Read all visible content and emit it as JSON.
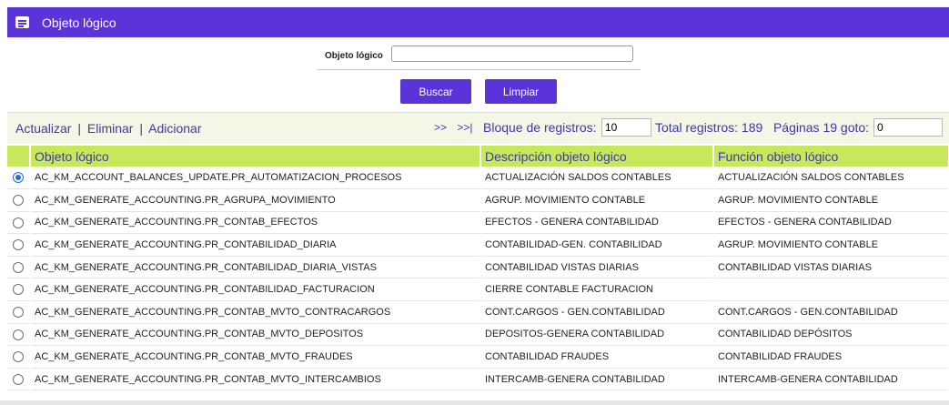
{
  "window": {
    "title": "Objeto lógico",
    "icon": "window-icon"
  },
  "search": {
    "label": "Objeto lógico",
    "value": ""
  },
  "buttons": {
    "buscar": "Buscar",
    "limpiar": "Limpiar"
  },
  "toolbar": {
    "actualizar": "Actualizar",
    "eliminar": "Eliminar",
    "adicionar": "Adicionar",
    "separator": "|",
    "next": ">>",
    "last": ">>|",
    "bloque_label": "Bloque de registros:",
    "bloque_value": "10",
    "total_label": "Total registros: 189",
    "paginas_label": "Páginas 19 goto:",
    "goto_value": "0"
  },
  "table": {
    "headers": [
      "Objeto lógico",
      "Descripción objeto lógico",
      "Función objeto lógico"
    ],
    "rows": [
      {
        "selected": true,
        "objeto": "AC_KM_ACCOUNT_BALANCES_UPDATE.PR_AUTOMATIZACION_PROCESOS",
        "descripcion": "ACTUALIZACIÓN SALDOS CONTABLES",
        "funcion": "ACTUALIZACIÓN SALDOS CONTABLES"
      },
      {
        "selected": false,
        "objeto": "AC_KM_GENERATE_ACCOUNTING.PR_AGRUPA_MOVIMIENTO",
        "descripcion": "AGRUP. MOVIMIENTO CONTABLE",
        "funcion": "AGRUP. MOVIMIENTO CONTABLE"
      },
      {
        "selected": false,
        "objeto": "AC_KM_GENERATE_ACCOUNTING.PR_CONTAB_EFECTOS",
        "descripcion": "EFECTOS - GENERA CONTABILIDAD",
        "funcion": "EFECTOS - GENERA CONTABILIDAD"
      },
      {
        "selected": false,
        "objeto": "AC_KM_GENERATE_ACCOUNTING.PR_CONTABILIDAD_DIARIA",
        "descripcion": "CONTABILIDAD-GEN. CONTABILIDAD",
        "funcion": "AGRUP. MOVIMIENTO CONTABLE"
      },
      {
        "selected": false,
        "objeto": "AC_KM_GENERATE_ACCOUNTING.PR_CONTABILIDAD_DIARIA_VISTAS",
        "descripcion": "CONTABILIDAD VISTAS DIARIAS",
        "funcion": "CONTABILIDAD VISTAS DIARIAS"
      },
      {
        "selected": false,
        "objeto": "AC_KM_GENERATE_ACCOUNTING.PR_CONTABILIDAD_FACTURACION",
        "descripcion": "CIERRE CONTABLE FACTURACION",
        "funcion": ""
      },
      {
        "selected": false,
        "objeto": "AC_KM_GENERATE_ACCOUNTING.PR_CONTAB_MVTO_CONTRACARGOS",
        "descripcion": "CONT.CARGOS - GEN.CONTABILIDAD",
        "funcion": "CONT.CARGOS - GEN.CONTABILIDAD"
      },
      {
        "selected": false,
        "objeto": "AC_KM_GENERATE_ACCOUNTING.PR_CONTAB_MVTO_DEPOSITOS",
        "descripcion": "DEPOSITOS-GENERA CONTABILIDAD",
        "funcion": "CONTABILIDAD DEPÓSITOS"
      },
      {
        "selected": false,
        "objeto": "AC_KM_GENERATE_ACCOUNTING.PR_CONTAB_MVTO_FRAUDES",
        "descripcion": "CONTABILIDAD FRAUDES",
        "funcion": "CONTABILIDAD FRAUDES"
      },
      {
        "selected": false,
        "objeto": "AC_KM_GENERATE_ACCOUNTING.PR_CONTAB_MVTO_INTERCAMBIOS",
        "descripcion": "INTERCAMB-GENERA CONTABILIDAD",
        "funcion": "INTERCAMB-GENERA CONTABILIDAD"
      }
    ]
  },
  "colors": {
    "accent": "#5a34d8",
    "header_bg": "#c6e85a",
    "link": "#3a3aa8"
  }
}
